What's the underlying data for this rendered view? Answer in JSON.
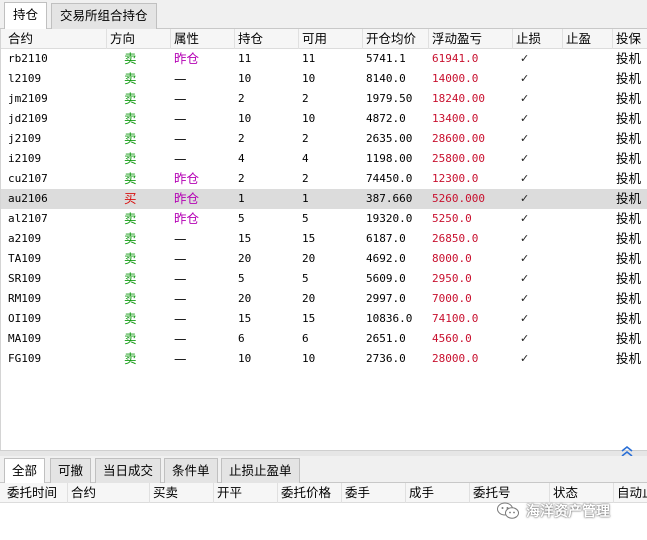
{
  "tabs_top": [
    {
      "label": "持仓",
      "active": true
    },
    {
      "label": "交易所组合持仓",
      "active": false
    }
  ],
  "positions": {
    "columns": [
      "合约",
      "方向",
      "属性",
      "持仓",
      "可用",
      "开仓均价",
      "浮动盈亏",
      "止损",
      "止盈",
      "投保"
    ],
    "rows": [
      {
        "contract": "rb2110",
        "side": "卖",
        "attr": "昨仓",
        "pos": "11",
        "avail": "11",
        "avg": "5741.1",
        "pnl": "61941.0",
        "stop_loss": "✓",
        "take_profit": "",
        "hedge": "投机"
      },
      {
        "contract": "l2109",
        "side": "卖",
        "attr": "—",
        "pos": "10",
        "avail": "10",
        "avg": "8140.0",
        "pnl": "14000.0",
        "stop_loss": "✓",
        "take_profit": "",
        "hedge": "投机"
      },
      {
        "contract": "jm2109",
        "side": "卖",
        "attr": "—",
        "pos": "2",
        "avail": "2",
        "avg": "1979.50",
        "pnl": "18240.00",
        "stop_loss": "✓",
        "take_profit": "",
        "hedge": "投机"
      },
      {
        "contract": "jd2109",
        "side": "卖",
        "attr": "—",
        "pos": "10",
        "avail": "10",
        "avg": "4872.0",
        "pnl": "13400.0",
        "stop_loss": "✓",
        "take_profit": "",
        "hedge": "投机"
      },
      {
        "contract": "j2109",
        "side": "卖",
        "attr": "—",
        "pos": "2",
        "avail": "2",
        "avg": "2635.00",
        "pnl": "28600.00",
        "stop_loss": "✓",
        "take_profit": "",
        "hedge": "投机"
      },
      {
        "contract": "i2109",
        "side": "卖",
        "attr": "—",
        "pos": "4",
        "avail": "4",
        "avg": "1198.00",
        "pnl": "25800.00",
        "stop_loss": "✓",
        "take_profit": "",
        "hedge": "投机"
      },
      {
        "contract": "cu2107",
        "side": "卖",
        "attr": "昨仓",
        "pos": "2",
        "avail": "2",
        "avg": "74450.0",
        "pnl": "12300.0",
        "stop_loss": "✓",
        "take_profit": "",
        "hedge": "投机"
      },
      {
        "contract": "au2106",
        "side": "买",
        "attr": "昨仓",
        "pos": "1",
        "avail": "1",
        "avg": "387.660",
        "pnl": "5260.000",
        "stop_loss": "✓",
        "take_profit": "",
        "hedge": "投机"
      },
      {
        "contract": "al2107",
        "side": "卖",
        "attr": "昨仓",
        "pos": "5",
        "avail": "5",
        "avg": "19320.0",
        "pnl": "5250.0",
        "stop_loss": "✓",
        "take_profit": "",
        "hedge": "投机"
      },
      {
        "contract": "a2109",
        "side": "卖",
        "attr": "—",
        "pos": "15",
        "avail": "15",
        "avg": "6187.0",
        "pnl": "26850.0",
        "stop_loss": "✓",
        "take_profit": "",
        "hedge": "投机"
      },
      {
        "contract": "TA109",
        "side": "卖",
        "attr": "—",
        "pos": "20",
        "avail": "20",
        "avg": "4692.0",
        "pnl": "8000.0",
        "stop_loss": "✓",
        "take_profit": "",
        "hedge": "投机"
      },
      {
        "contract": "SR109",
        "side": "卖",
        "attr": "—",
        "pos": "5",
        "avail": "5",
        "avg": "5609.0",
        "pnl": "2950.0",
        "stop_loss": "✓",
        "take_profit": "",
        "hedge": "投机"
      },
      {
        "contract": "RM109",
        "side": "卖",
        "attr": "—",
        "pos": "20",
        "avail": "20",
        "avg": "2997.0",
        "pnl": "7000.0",
        "stop_loss": "✓",
        "take_profit": "",
        "hedge": "投机"
      },
      {
        "contract": "OI109",
        "side": "卖",
        "attr": "—",
        "pos": "15",
        "avail": "15",
        "avg": "10836.0",
        "pnl": "74100.0",
        "stop_loss": "✓",
        "take_profit": "",
        "hedge": "投机"
      },
      {
        "contract": "MA109",
        "side": "卖",
        "attr": "—",
        "pos": "6",
        "avail": "6",
        "avg": "2651.0",
        "pnl": "4560.0",
        "stop_loss": "✓",
        "take_profit": "",
        "hedge": "投机"
      },
      {
        "contract": "FG109",
        "side": "卖",
        "attr": "—",
        "pos": "10",
        "avail": "10",
        "avg": "2736.0",
        "pnl": "28000.0",
        "stop_loss": "✓",
        "take_profit": "",
        "hedge": "投机"
      }
    ],
    "selected_row": 7
  },
  "tabs_bottom": [
    {
      "label": "全部",
      "active": true
    },
    {
      "label": "可撤",
      "active": false
    },
    {
      "label": "当日成交",
      "active": false
    },
    {
      "label": "条件单",
      "active": false
    },
    {
      "label": "止损止盈单",
      "active": false
    }
  ],
  "orders": {
    "columns": [
      "委托时间",
      "合约",
      "买卖",
      "开平",
      "委托价格",
      "委手",
      "成手",
      "委托号",
      "状态",
      "自动止"
    ]
  },
  "watermark": {
    "text": "海洋资产管理",
    "icon": "wechat-icon"
  },
  "colors": {
    "sell": "#139a13",
    "buy": "#d8100f",
    "prev_position": "#b400b4",
    "pnl": "#c8102e",
    "selected_row": "#dcdcdc"
  }
}
